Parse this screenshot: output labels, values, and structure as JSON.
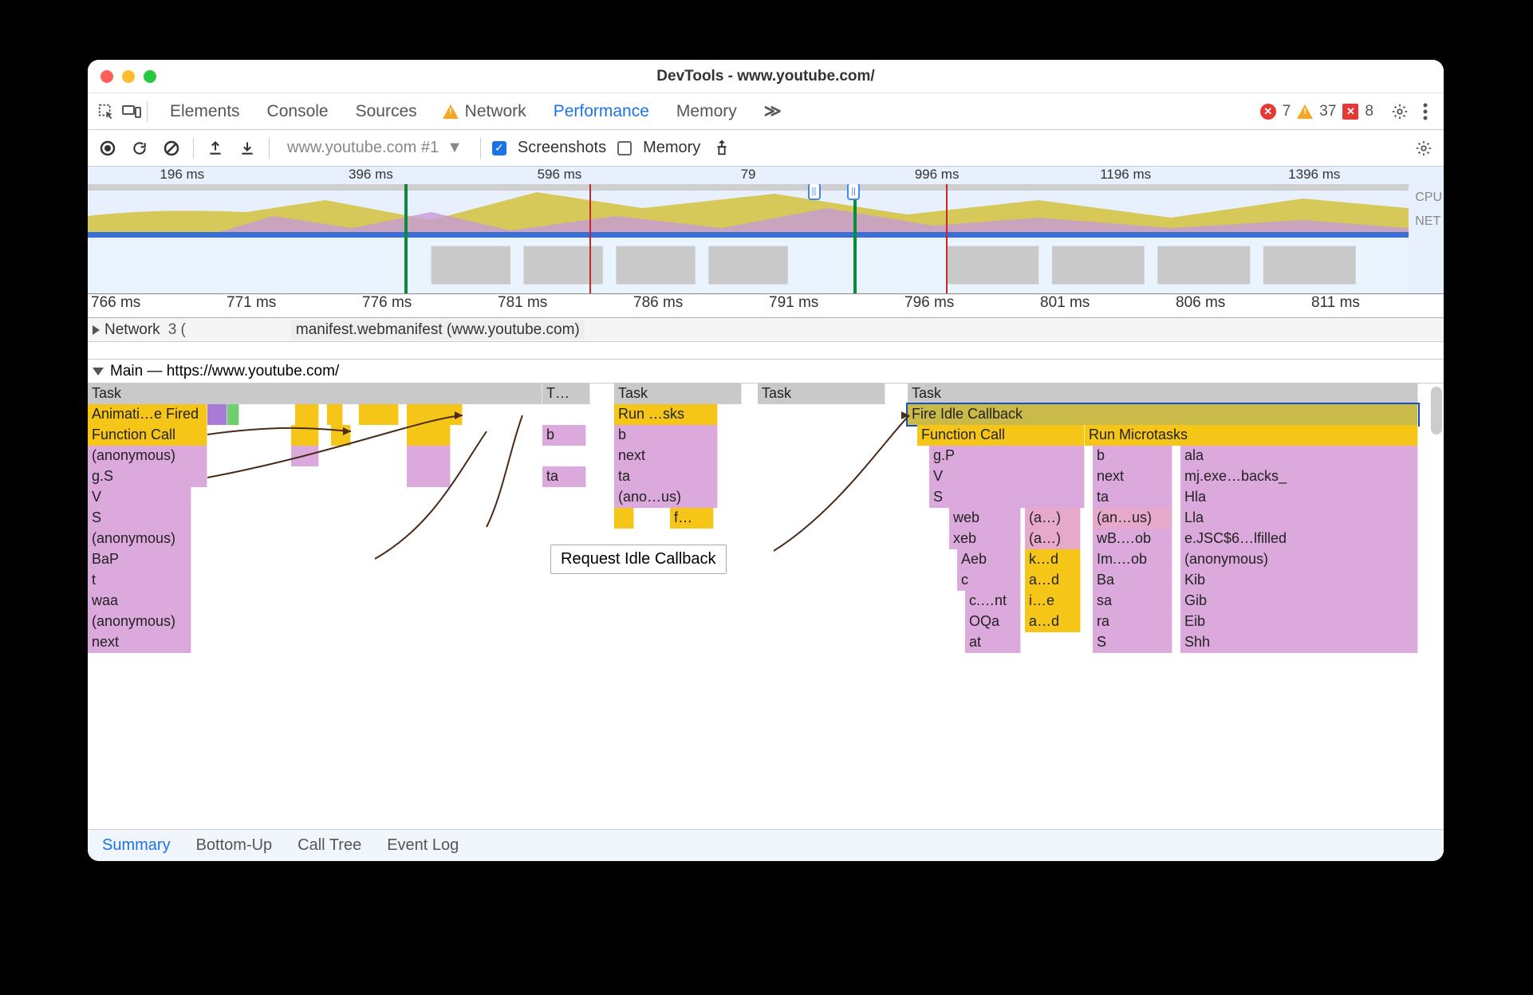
{
  "window": {
    "title": "DevTools - www.youtube.com/"
  },
  "tabs": {
    "items": [
      "Elements",
      "Console",
      "Sources",
      "Network",
      "Performance",
      "Memory"
    ],
    "active": "Performance",
    "warn_before": "Network",
    "overflow_glyph": "≫"
  },
  "status": {
    "errors": 7,
    "warnings": 37,
    "blocked": 8
  },
  "toolbar": {
    "recording_dropdown": "www.youtube.com #1",
    "screenshots_label": "Screenshots",
    "screenshots_checked": true,
    "memory_label": "Memory",
    "memory_checked": false
  },
  "overview": {
    "ticks": [
      "196 ms",
      "396 ms",
      "596 ms",
      "79",
      "996 ms",
      "1196 ms",
      "1396 ms"
    ],
    "side_labels": [
      "CPU",
      "NET"
    ]
  },
  "ruler": [
    "766 ms",
    "771 ms",
    "776 ms",
    "781 ms",
    "786 ms",
    "791 ms",
    "796 ms",
    "801 ms",
    "806 ms",
    "811 ms"
  ],
  "network_row": {
    "label": "Network",
    "count": "3 (",
    "item": "manifest.webmanifest (www.youtube.com)"
  },
  "main_header": "Main — https://www.youtube.com/",
  "callout": "Request Idle Callback",
  "flame": {
    "left_stack": [
      "Animati…e Fired",
      "Function Call",
      "(anonymous)",
      "g.S",
      "V",
      "S",
      "(anonymous)",
      "BaP",
      "t",
      "waa",
      "(anonymous)",
      "next"
    ],
    "task_labels": [
      "Task",
      "T…",
      "Task",
      "Task",
      "Task"
    ],
    "mid_col": [
      "Run …sks",
      "b",
      "next",
      "ta",
      "(ano…us)",
      "f…"
    ],
    "mid_small": [
      "b",
      "ta"
    ],
    "right_block": {
      "row0": "Fire Idle Callback",
      "row1": [
        "Function Call",
        "Run Microtasks"
      ],
      "row2": [
        "g.P",
        "b",
        "ala"
      ],
      "row3": [
        "V",
        "next",
        "mj.exe…backs_"
      ],
      "row4": [
        "S",
        "ta",
        "Hla"
      ],
      "row5": [
        "web",
        "(a…)",
        "(an…us)",
        "Lla"
      ],
      "row6": [
        "xeb",
        "(a…)",
        "wB.…ob",
        "e.JSC$6…lfilled"
      ],
      "row7": [
        "Aeb",
        "k…d",
        "Im.…ob",
        "(anonymous)"
      ],
      "row8": [
        "c",
        "a…d",
        "Ba",
        "Kib"
      ],
      "row9": [
        "c.…nt",
        "i…e",
        "sa",
        "Gib"
      ],
      "row10": [
        "OQa",
        "a…d",
        "ra",
        "Eib"
      ],
      "row11": [
        "at",
        "",
        "S",
        "Shh"
      ]
    }
  },
  "bottom_tabs": {
    "items": [
      "Summary",
      "Bottom-Up",
      "Call Tree",
      "Event Log"
    ],
    "active": "Summary"
  }
}
